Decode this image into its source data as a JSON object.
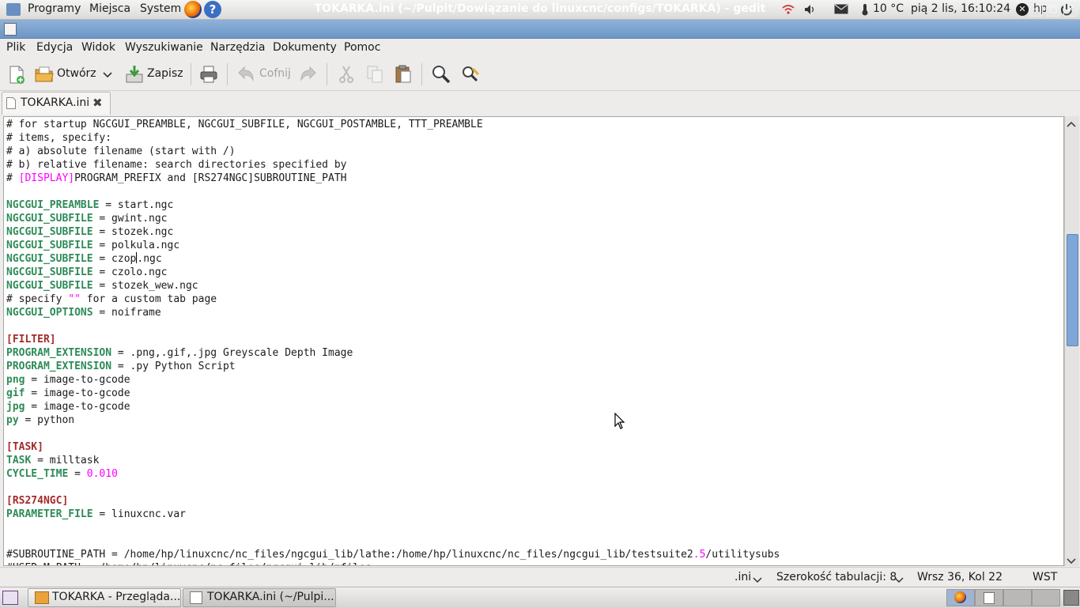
{
  "top_panel": {
    "menus": [
      "Programy",
      "Miejsca",
      "System"
    ],
    "weather": "10 °C",
    "clock": "pią  2 lis, 16:10:24",
    "user": "hp"
  },
  "window": {
    "title": "TOKARKA.ini (~/Pulpit/Dowiązanie do linuxcnc/configs/TOKARKA) - gedit",
    "controls": {
      "minimize": "−",
      "maximize": "□",
      "close": "✕"
    }
  },
  "menubar": {
    "items": [
      {
        "label": "Plik"
      },
      {
        "label": "Edycja"
      },
      {
        "label": "Widok"
      },
      {
        "label": "Wyszukiwanie"
      },
      {
        "label": "Narzędzia"
      },
      {
        "label": "Dokumenty"
      },
      {
        "label": "Pomoc"
      }
    ]
  },
  "toolbar": {
    "open_label": "Otwórz",
    "save_label": "Zapisz",
    "undo_label": "Cofnij"
  },
  "tab": {
    "label": "TOKARKA.ini"
  },
  "editor": {
    "lines": [
      [
        {
          "t": "# for startup NGCGUI_PREAMBLE, NGCGUI_SUBFILE, NGCGUI_POSTAMBLE, TTT_PREAMBLE"
        }
      ],
      [
        {
          "t": "# items, specify:"
        }
      ],
      [
        {
          "t": "# a) absolute filename (start with /)"
        }
      ],
      [
        {
          "t": "# b) relative filename: search directories specified by"
        }
      ],
      [
        {
          "t": "# "
        },
        {
          "t": "[DISPLAY]",
          "c": "num"
        },
        {
          "t": "PROGRAM_PREFIX and [RS274NGC]SUBROUTINE_PATH"
        }
      ],
      [
        {
          "t": ""
        }
      ],
      [
        {
          "t": "NGCGUI_PREAMBLE",
          "c": "k"
        },
        {
          "t": " = start.ngc"
        }
      ],
      [
        {
          "t": "NGCGUI_SUBFILE",
          "c": "k"
        },
        {
          "t": " = gwint.ngc"
        }
      ],
      [
        {
          "t": "NGCGUI_SUBFILE",
          "c": "k"
        },
        {
          "t": " = stozek.ngc"
        }
      ],
      [
        {
          "t": "NGCGUI_SUBFILE",
          "c": "k"
        },
        {
          "t": " = polkula.ngc"
        }
      ],
      [
        {
          "t": "NGCGUI_SUBFILE",
          "c": "k"
        },
        {
          "t": " = czop"
        },
        {
          "cursor": true
        },
        {
          "t": ".ngc"
        }
      ],
      [
        {
          "t": "NGCGUI_SUBFILE",
          "c": "k"
        },
        {
          "t": " = czolo.ngc"
        }
      ],
      [
        {
          "t": "NGCGUI_SUBFILE",
          "c": "k"
        },
        {
          "t": " = stozek_wew.ngc"
        }
      ],
      [
        {
          "t": "# specify "
        },
        {
          "t": "\"\"",
          "c": "num"
        },
        {
          "t": " for a custom tab page"
        }
      ],
      [
        {
          "t": "NGCGUI_OPTIONS",
          "c": "k"
        },
        {
          "t": " = noiframe"
        }
      ],
      [
        {
          "t": ""
        }
      ],
      [
        {
          "t": "[FILTER]",
          "c": "sec"
        }
      ],
      [
        {
          "t": "PROGRAM_EXTENSION",
          "c": "k"
        },
        {
          "t": " = .png,.gif,.jpg Greyscale Depth Image"
        }
      ],
      [
        {
          "t": "PROGRAM_EXTENSION",
          "c": "k"
        },
        {
          "t": " = .py Python Script"
        }
      ],
      [
        {
          "t": "png",
          "c": "k"
        },
        {
          "t": " = image-to-gcode"
        }
      ],
      [
        {
          "t": "gif",
          "c": "k"
        },
        {
          "t": " = image-to-gcode"
        }
      ],
      [
        {
          "t": "jpg",
          "c": "k"
        },
        {
          "t": " = image-to-gcode"
        }
      ],
      [
        {
          "t": "py",
          "c": "k"
        },
        {
          "t": " = python"
        }
      ],
      [
        {
          "t": ""
        }
      ],
      [
        {
          "t": "[TASK]",
          "c": "sec"
        }
      ],
      [
        {
          "t": "TASK",
          "c": "k"
        },
        {
          "t": " = milltask"
        }
      ],
      [
        {
          "t": "CYCLE_TIME",
          "c": "k"
        },
        {
          "t": " = "
        },
        {
          "t": "0.010",
          "c": "num"
        }
      ],
      [
        {
          "t": ""
        }
      ],
      [
        {
          "t": "[RS274NGC]",
          "c": "sec"
        }
      ],
      [
        {
          "t": "PARAMETER_FILE",
          "c": "k"
        },
        {
          "t": " = linuxcnc.var"
        }
      ],
      [
        {
          "t": ""
        }
      ],
      [
        {
          "t": ""
        }
      ],
      [
        {
          "t": "#SUBROUTINE_PATH = /home/hp/linuxcnc/nc_files/ngcgui_lib/lathe:/home/hp/linuxcnc/nc_files/ngcgui_lib/testsuite2"
        },
        {
          "t": ".5",
          "c": "num"
        },
        {
          "t": "/utilitysubs"
        }
      ],
      [
        {
          "t": "#USER_M_PATH = /home/hp/linuxcnc/nc_files/ngcgui_lib/mfiles"
        }
      ]
    ]
  },
  "statusbar": {
    "language": ".ini",
    "tab_width": "Szerokość tabulacji: 8",
    "position": "Wrsz 36, Kol 22",
    "mode": "WST"
  },
  "taskbar": {
    "items": [
      {
        "label": "TOKARKA - Przegląda..."
      },
      {
        "label": "TOKARKA.ini (~/Pulpi..."
      }
    ]
  },
  "colors": {
    "keyword": "#2e8b57",
    "section": "#a52a2a",
    "number": "#ff00ff",
    "titlebar": "#7aa0cf"
  }
}
